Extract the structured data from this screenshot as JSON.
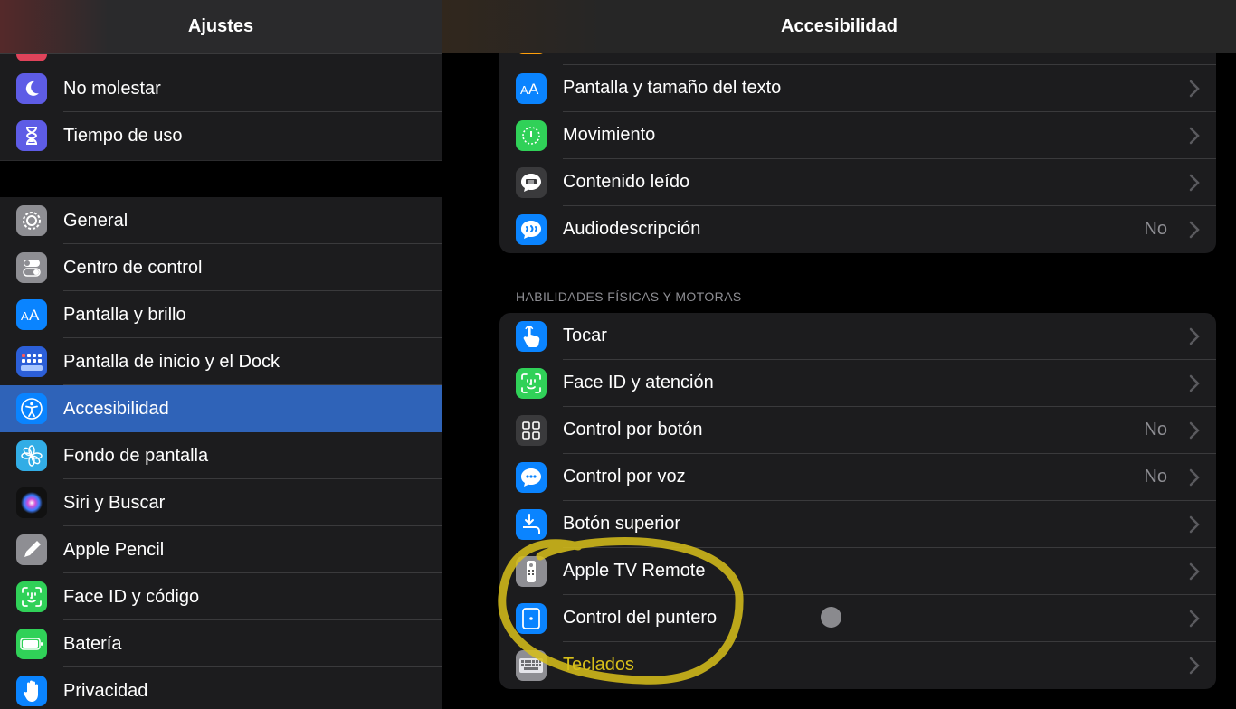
{
  "sidebar": {
    "title": "Ajustes",
    "group1": [
      {
        "label": "No molestar",
        "icon": "moon-icon",
        "color": "#5e5ce6"
      },
      {
        "label": "Tiempo de uso",
        "icon": "hourglass-icon",
        "color": "#5e5ce6"
      }
    ],
    "group2": [
      {
        "label": "General",
        "icon": "gear-icon",
        "color": "#8e8e93"
      },
      {
        "label": "Centro de control",
        "icon": "toggles-icon",
        "color": "#8e8e93"
      },
      {
        "label": "Pantalla y brillo",
        "icon": "text-size-icon",
        "color": "#0a84ff"
      },
      {
        "label": "Pantalla de inicio y el Dock",
        "icon": "app-grid-icon",
        "color": "#2c5fd8"
      },
      {
        "label": "Accesibilidad",
        "icon": "accessibility-icon",
        "color": "#0a84ff",
        "selected": true
      },
      {
        "label": "Fondo de pantalla",
        "icon": "flower-icon",
        "color": "#32ade6"
      },
      {
        "label": "Siri y Buscar",
        "icon": "siri-icon",
        "color": "#000000"
      },
      {
        "label": "Apple Pencil",
        "icon": "pencil-icon",
        "color": "#8e8e93"
      },
      {
        "label": "Face ID y código",
        "icon": "face-id-icon",
        "color": "#30d158"
      },
      {
        "label": "Batería",
        "icon": "battery-icon",
        "color": "#30d158"
      },
      {
        "label": "Privacidad",
        "icon": "hand-icon",
        "color": "#0a84ff"
      }
    ]
  },
  "main": {
    "title": "Accesibilidad",
    "vision_items": [
      {
        "label": "Pantalla y tamaño del texto",
        "icon": "text-size-icon",
        "color": "#0a84ff",
        "value": ""
      },
      {
        "label": "Movimiento",
        "icon": "motion-icon",
        "color": "#30d158",
        "value": ""
      },
      {
        "label": "Contenido leído",
        "icon": "speech-bubble-icon",
        "color": "#3a3a3c",
        "value": ""
      },
      {
        "label": "Audiodescripción",
        "icon": "audio-description-icon",
        "color": "#0a84ff",
        "value": "No"
      }
    ],
    "physical_section_title": "HABILIDADES FÍSICAS Y MOTORAS",
    "physical_items": [
      {
        "label": "Tocar",
        "icon": "touch-hand-icon",
        "color": "#0a84ff",
        "value": ""
      },
      {
        "label": "Face ID y atención",
        "icon": "face-id-icon",
        "color": "#30d158",
        "value": ""
      },
      {
        "label": "Control por botón",
        "icon": "switch-grid-icon",
        "color": "#3a3a3c",
        "value": "No"
      },
      {
        "label": "Control por voz",
        "icon": "voice-control-icon",
        "color": "#0a84ff",
        "value": "No"
      },
      {
        "label": "Botón superior",
        "icon": "top-button-icon",
        "color": "#0a84ff",
        "value": ""
      },
      {
        "label": "Apple TV Remote",
        "icon": "remote-icon",
        "color": "#8e8e93",
        "value": ""
      },
      {
        "label": "Control del puntero",
        "icon": "pointer-icon",
        "color": "#0a84ff",
        "value": ""
      },
      {
        "label": "Teclados",
        "icon": "keyboard-icon",
        "color": "#8e8e93",
        "value": ""
      }
    ]
  },
  "annotation": {
    "highlight_color": "#d8c01a"
  }
}
